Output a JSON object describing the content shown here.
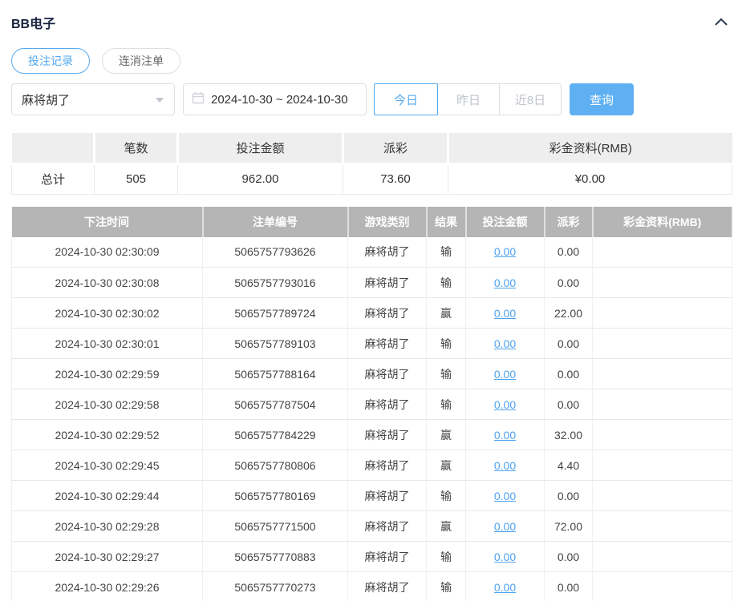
{
  "header": {
    "title": "BB电子",
    "collapse_icon": "chevron-up"
  },
  "tabs": [
    {
      "label": "投注记录",
      "active": true
    },
    {
      "label": "连消注单",
      "active": false
    }
  ],
  "filters": {
    "game_select": {
      "value": "麻将胡了",
      "icon": "caret-down"
    },
    "date_range": {
      "value": "2024-10-30 ~ 2024-10-30",
      "icon": "calendar"
    },
    "quick_buttons": [
      {
        "label": "今日",
        "active": true
      },
      {
        "label": "昨日",
        "active": false
      },
      {
        "label": "近8日",
        "active": false
      }
    ],
    "query_label": "查询"
  },
  "summary": {
    "headers": [
      "",
      "笔数",
      "投注金额",
      "派彩",
      "彩金资料(RMB)"
    ],
    "row": {
      "label": "总计",
      "count": "505",
      "bet_amount": "962.00",
      "payout": "73.60",
      "bonus": "¥0.00"
    }
  },
  "table": {
    "headers": [
      "下注时间",
      "注单编号",
      "游戏类别",
      "结果",
      "投注金额",
      "派彩",
      "彩金资料(RMB)"
    ],
    "rows": [
      {
        "time": "2024-10-30 02:30:09",
        "id": "5065757793626",
        "game": "麻将胡了",
        "result": "输",
        "bet": "0.00",
        "payout": "0.00",
        "bonus": ""
      },
      {
        "time": "2024-10-30 02:30:08",
        "id": "5065757793016",
        "game": "麻将胡了",
        "result": "输",
        "bet": "0.00",
        "payout": "0.00",
        "bonus": ""
      },
      {
        "time": "2024-10-30 02:30:02",
        "id": "5065757789724",
        "game": "麻将胡了",
        "result": "赢",
        "bet": "0.00",
        "payout": "22.00",
        "bonus": ""
      },
      {
        "time": "2024-10-30 02:30:01",
        "id": "5065757789103",
        "game": "麻将胡了",
        "result": "输",
        "bet": "0.00",
        "payout": "0.00",
        "bonus": ""
      },
      {
        "time": "2024-10-30 02:29:59",
        "id": "5065757788164",
        "game": "麻将胡了",
        "result": "输",
        "bet": "0.00",
        "payout": "0.00",
        "bonus": ""
      },
      {
        "time": "2024-10-30 02:29:58",
        "id": "5065757787504",
        "game": "麻将胡了",
        "result": "输",
        "bet": "0.00",
        "payout": "0.00",
        "bonus": ""
      },
      {
        "time": "2024-10-30 02:29:52",
        "id": "5065757784229",
        "game": "麻将胡了",
        "result": "赢",
        "bet": "0.00",
        "payout": "32.00",
        "bonus": ""
      },
      {
        "time": "2024-10-30 02:29:45",
        "id": "5065757780806",
        "game": "麻将胡了",
        "result": "赢",
        "bet": "0.00",
        "payout": "4.40",
        "bonus": ""
      },
      {
        "time": "2024-10-30 02:29:44",
        "id": "5065757780169",
        "game": "麻将胡了",
        "result": "输",
        "bet": "0.00",
        "payout": "0.00",
        "bonus": ""
      },
      {
        "time": "2024-10-30 02:29:28",
        "id": "5065757771500",
        "game": "麻将胡了",
        "result": "赢",
        "bet": "0.00",
        "payout": "72.00",
        "bonus": ""
      },
      {
        "time": "2024-10-30 02:29:27",
        "id": "5065757770883",
        "game": "麻将胡了",
        "result": "输",
        "bet": "0.00",
        "payout": "0.00",
        "bonus": ""
      },
      {
        "time": "2024-10-30 02:29:26",
        "id": "5065757770273",
        "game": "麻将胡了",
        "result": "输",
        "bet": "0.00",
        "payout": "0.00",
        "bonus": ""
      }
    ]
  },
  "colors": {
    "accent_blue": "#54a9f0",
    "query_button_bg": "#5fb0f2",
    "link_blue": "#4da3f0",
    "main_table_header_bg": "#b5b5b5",
    "summary_header_bg": "#eeeeee",
    "inactive_text": "#c0c4cc",
    "title_text": "#17233d"
  }
}
